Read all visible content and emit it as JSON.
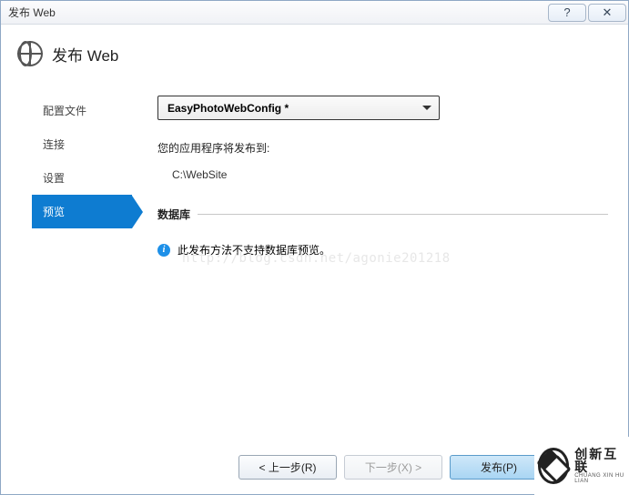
{
  "window": {
    "title": "发布 Web",
    "help_glyph": "?",
    "close_glyph": "✕"
  },
  "header": {
    "title": "发布 Web"
  },
  "sidebar": {
    "items": [
      {
        "label": "配置文件"
      },
      {
        "label": "连接"
      },
      {
        "label": "设置"
      },
      {
        "label": "预览"
      }
    ],
    "active_index": 3
  },
  "main": {
    "profile_dropdown": {
      "selected": "EasyPhotoWebConfig *"
    },
    "publish_to_label": "您的应用程序将发布到:",
    "publish_to_value": "C:\\WebSite",
    "db_section_title": "数据库",
    "db_info_icon": "i",
    "db_info_text": "此发布方法不支持数据库预览。"
  },
  "watermark": "http://blog.csdn.net/agonie201218",
  "footer": {
    "prev": "< 上一步(R)",
    "next": "下一步(X) >",
    "publish": "发布(P)"
  },
  "brand": {
    "cn": "创新互联",
    "en": "CHUANG XIN HU LIAN"
  }
}
